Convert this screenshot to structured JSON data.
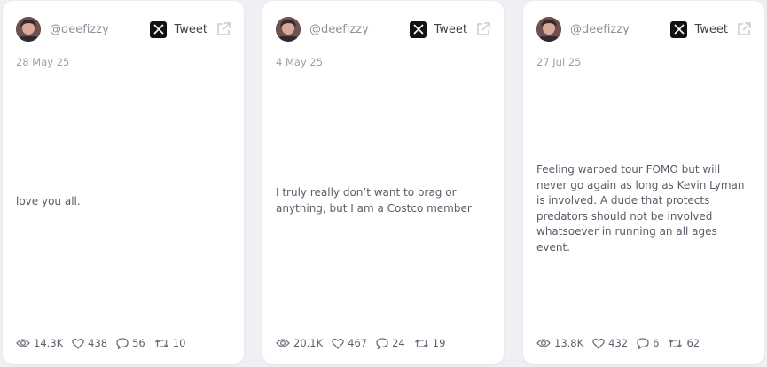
{
  "cards": [
    {
      "handle": "@deefizzy",
      "tweet_label": "Tweet",
      "date": "28 May 25",
      "text": "love you all.",
      "stats": {
        "views": "14.3K",
        "likes": "438",
        "replies": "56",
        "retweets": "10"
      }
    },
    {
      "handle": "@deefizzy",
      "tweet_label": "Tweet",
      "date": "4 May 25",
      "text": "I truly really don’t want to brag or anything, but I am a Costco member",
      "stats": {
        "views": "20.1K",
        "likes": "467",
        "replies": "24",
        "retweets": "19"
      }
    },
    {
      "handle": "@deefizzy",
      "tweet_label": "Tweet",
      "date": "27 Jul 25",
      "text": "Feeling warped tour FOMO but will never go again as long as Kevin Lyman is involved. A dude that protects predators should not be involved whatsoever in running an all ages event.",
      "stats": {
        "views": "13.8K",
        "likes": "432",
        "replies": "6",
        "retweets": "62"
      }
    }
  ],
  "icons": {
    "x": "x-logo-icon",
    "external": "external-link-icon",
    "views": "eye-icon",
    "likes": "heart-icon",
    "replies": "comment-icon",
    "retweets": "retweet-icon"
  }
}
